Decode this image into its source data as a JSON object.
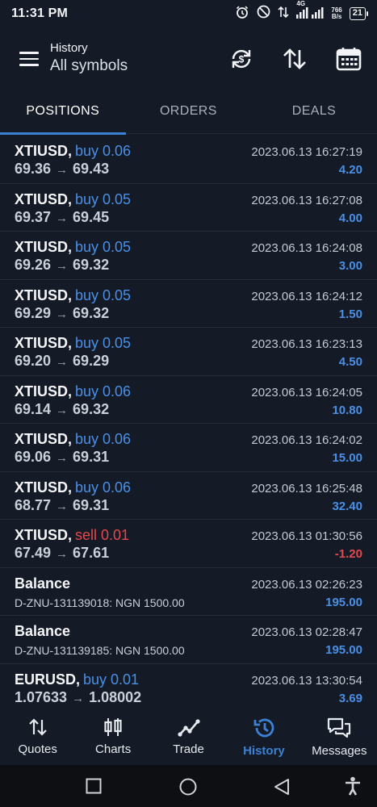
{
  "status_bar": {
    "time": "11:31 PM",
    "network_label": "4G",
    "speed_value": "766",
    "speed_unit": "B/s",
    "battery": "21"
  },
  "header": {
    "title": "History",
    "subtitle": "All symbols",
    "icons": [
      "currency-exchange-icon",
      "sort-icon",
      "calendar-icon"
    ]
  },
  "tabs": [
    {
      "label": "POSITIONS",
      "active": true
    },
    {
      "label": "ORDERS",
      "active": false
    },
    {
      "label": "DEALS",
      "active": false
    }
  ],
  "rows": [
    {
      "symbol": "XTIUSD,",
      "direction": "buy 0.06",
      "type": "buy",
      "open": "69.36",
      "arrow": "→",
      "close": "69.43",
      "date": "2023.06.13 16:27:19",
      "profit": "4.20",
      "profit_sign": "pos"
    },
    {
      "symbol": "XTIUSD,",
      "direction": "buy 0.05",
      "type": "buy",
      "open": "69.37",
      "arrow": "→",
      "close": "69.45",
      "date": "2023.06.13 16:27:08",
      "profit": "4.00",
      "profit_sign": "pos"
    },
    {
      "symbol": "XTIUSD,",
      "direction": "buy 0.05",
      "type": "buy",
      "open": "69.26",
      "arrow": "→",
      "close": "69.32",
      "date": "2023.06.13 16:24:08",
      "profit": "3.00",
      "profit_sign": "pos"
    },
    {
      "symbol": "XTIUSD,",
      "direction": "buy 0.05",
      "type": "buy",
      "open": "69.29",
      "arrow": "→",
      "close": "69.32",
      "date": "2023.06.13 16:24:12",
      "profit": "1.50",
      "profit_sign": "pos"
    },
    {
      "symbol": "XTIUSD,",
      "direction": "buy 0.05",
      "type": "buy",
      "open": "69.20",
      "arrow": "→",
      "close": "69.29",
      "date": "2023.06.13 16:23:13",
      "profit": "4.50",
      "profit_sign": "pos"
    },
    {
      "symbol": "XTIUSD,",
      "direction": "buy 0.06",
      "type": "buy",
      "open": "69.14",
      "arrow": "→",
      "close": "69.32",
      "date": "2023.06.13 16:24:05",
      "profit": "10.80",
      "profit_sign": "pos"
    },
    {
      "symbol": "XTIUSD,",
      "direction": "buy 0.06",
      "type": "buy",
      "open": "69.06",
      "arrow": "→",
      "close": "69.31",
      "date": "2023.06.13 16:24:02",
      "profit": "15.00",
      "profit_sign": "pos"
    },
    {
      "symbol": "XTIUSD,",
      "direction": "buy 0.06",
      "type": "buy",
      "open": "68.77",
      "arrow": "→",
      "close": "69.31",
      "date": "2023.06.13 16:25:48",
      "profit": "32.40",
      "profit_sign": "pos"
    },
    {
      "symbol": "XTIUSD,",
      "direction": "sell 0.01",
      "type": "sell",
      "open": "67.49",
      "arrow": "→",
      "close": "67.61",
      "date": "2023.06.13 01:30:56",
      "profit": "-1.20",
      "profit_sign": "neg"
    },
    {
      "symbol": "Balance",
      "balance": true,
      "comment": "D-ZNU-131139018: NGN 1500.00",
      "date": "2023.06.13 02:26:23",
      "profit": "195.00",
      "profit_sign": "pos"
    },
    {
      "symbol": "Balance",
      "balance": true,
      "comment": "D-ZNU-131139185: NGN 1500.00",
      "date": "2023.06.13 02:28:47",
      "profit": "195.00",
      "profit_sign": "pos"
    },
    {
      "symbol": "EURUSD,",
      "direction": "buy 0.01",
      "type": "buy",
      "open": "1.07633",
      "arrow": "→",
      "close": "1.08002",
      "date": "2023.06.13 13:30:54",
      "profit": "3.69",
      "profit_sign": "pos"
    }
  ],
  "bottom_nav": [
    {
      "label": "Quotes",
      "icon": "quotes-icon",
      "active": false
    },
    {
      "label": "Charts",
      "icon": "charts-icon",
      "active": false
    },
    {
      "label": "Trade",
      "icon": "trade-icon",
      "active": false
    },
    {
      "label": "History",
      "icon": "history-icon",
      "active": true
    },
    {
      "label": "Messages",
      "icon": "messages-icon",
      "active": false
    }
  ],
  "colors": {
    "accent": "#3b82d4",
    "buy": "#4a8fe6",
    "sell": "#e5484d",
    "background": "#151b26"
  }
}
